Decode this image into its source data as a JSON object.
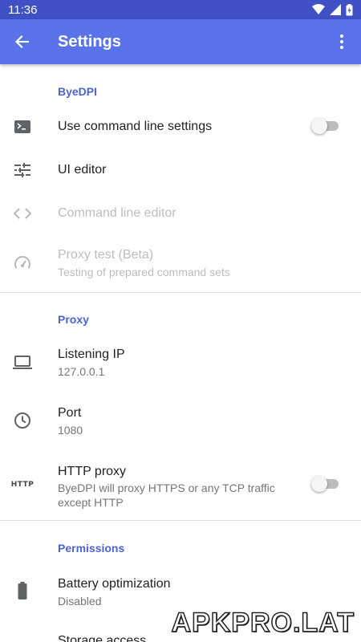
{
  "status_bar": {
    "time": "11:36"
  },
  "app_bar": {
    "title": "Settings"
  },
  "sections": [
    {
      "category": "ByeDPI",
      "items": [
        {
          "icon": "terminal-icon",
          "title": "Use command line settings",
          "switch": false
        },
        {
          "icon": "tune-icon",
          "title": "UI editor"
        },
        {
          "icon": "code-icon",
          "title": "Command line editor",
          "disabled": true
        },
        {
          "icon": "speedometer-icon",
          "title": "Proxy test (Beta)",
          "summary": "Testing of prepared command sets",
          "disabled": true
        }
      ]
    },
    {
      "category": "Proxy",
      "items": [
        {
          "icon": "laptop-icon",
          "title": "Listening IP",
          "summary": "127.0.0.1"
        },
        {
          "icon": "clock-icon",
          "title": "Port",
          "summary": "1080"
        },
        {
          "icon": "http-icon",
          "icon_text": "HTTP",
          "title": "HTTP proxy",
          "summary": "ByeDPI will proxy HTTPS or any TCP traffic except HTTP",
          "switch": false
        }
      ]
    },
    {
      "category": "Permissions",
      "items": [
        {
          "icon": "battery-icon",
          "title": "Battery optimization",
          "summary": "Disabled"
        },
        {
          "title": "Storage access"
        }
      ]
    }
  ],
  "watermark": "APKPRO.LAT",
  "colors": {
    "app_bar": "#5b73e8",
    "status_bar": "#3f51c4",
    "accent": "#4a63d8"
  }
}
